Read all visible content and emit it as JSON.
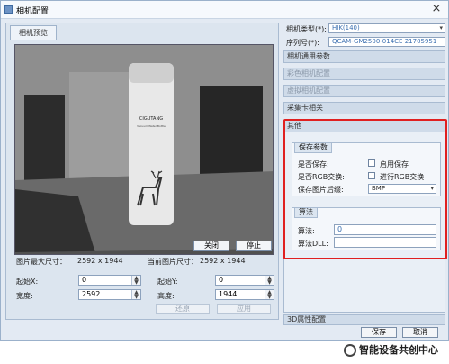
{
  "window": {
    "title": "相机配置",
    "close_symbol": "×"
  },
  "left": {
    "tab_label": "相机预览",
    "close_button": "关闭",
    "stop_button": "停止",
    "max_size_label": "图片最大尺寸：",
    "max_size_value": "2592 x 1944",
    "cur_size_label": "当前图片尺寸：",
    "cur_size_value": "2592 x 1944",
    "start_x_label": "起始X:",
    "start_x_value": "0",
    "start_y_label": "起始Y:",
    "start_y_value": "0",
    "width_label": "宽度:",
    "width_value": "2592",
    "height_label": "高度:",
    "height_value": "1944",
    "restore_button": "还原",
    "apply_button": "应用",
    "preview": {
      "brand": "CIGUTANG",
      "bottle_subtext": "Vacuum Water Bottle"
    }
  },
  "right": {
    "camera_type_label": "相机类型(*):",
    "camera_type_value": "HIK(140)",
    "serial_label": "序列号(*):",
    "serial_value": "QCAM-GM2500-014CE 21705951",
    "sections": [
      {
        "label": "相机通用参数",
        "active": true
      },
      {
        "label": "彩色相机配置",
        "active": false
      },
      {
        "label": "虚拟相机配置",
        "active": false
      },
      {
        "label": "采集卡相关",
        "active": true
      }
    ],
    "other": {
      "header": "其他",
      "save_group_title": "保存参数",
      "save_q_label": "是否保存:",
      "save_check_label": "启用保存",
      "rgb_q_label": "是否RGB交换:",
      "rgb_check_label": "进行RGB交换",
      "format_label": "保存图片后缀:",
      "format_value": "BMP",
      "algo_group_title": "算法",
      "algo_label": "算法:",
      "algo_value": "0",
      "algo_dll_label": "算法DLL:",
      "algo_dll_value": ""
    },
    "section_3d": "3D属性配置",
    "save_button": "保存",
    "cancel_button": "取消"
  },
  "watermark": "智能设备共创中心"
}
